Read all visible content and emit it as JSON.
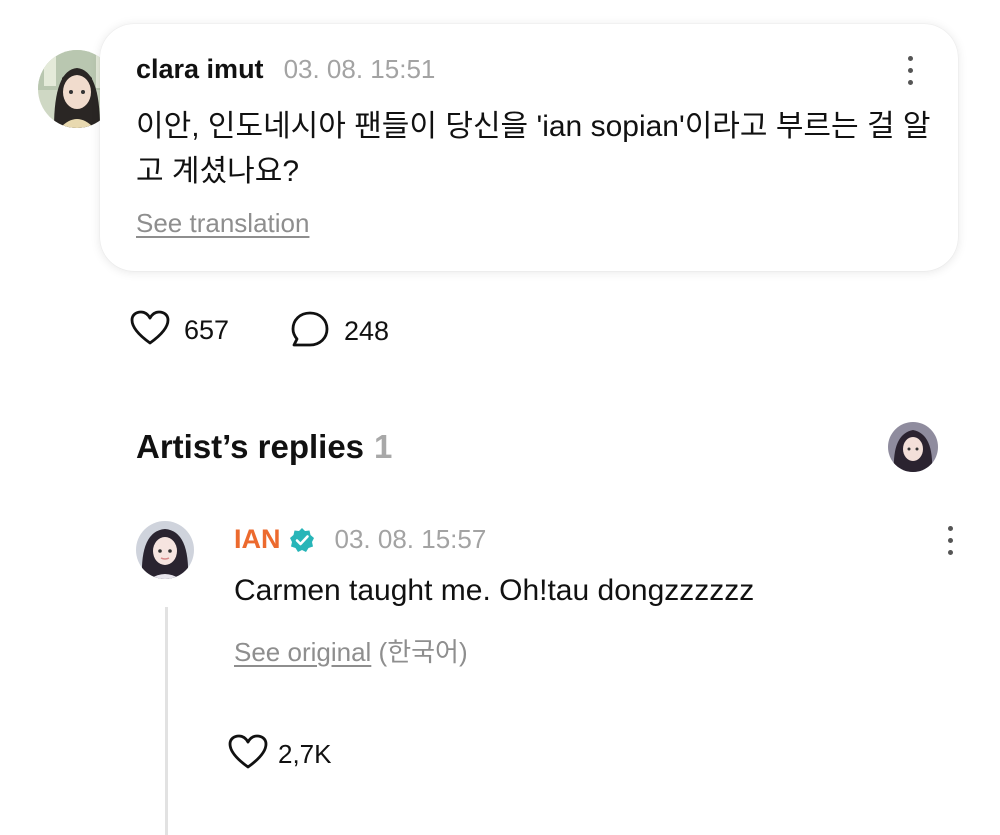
{
  "post": {
    "author": "clara imut",
    "timestamp": "03. 08. 15:51",
    "text": "이안, 인도네시아 팬들이 당신을 'ian sopian'이라고 부르는 걸 알고 계셨나요?",
    "see_translation": "See translation",
    "likes": "657",
    "comments": "248"
  },
  "artist_replies": {
    "title": "Artist’s replies",
    "count": "1"
  },
  "reply": {
    "author": "IAN",
    "timestamp": "03. 08. 15:57",
    "text": "Carmen taught me. Oh!tau dongzzzzzz",
    "see_original": "See original",
    "original_language": "(한국어)",
    "likes": "2,7K"
  },
  "colors": {
    "artist_name": "#ec6a2e",
    "verified_badge": "#27b5b8",
    "muted_text": "#a3a3a3"
  },
  "icons": [
    "kebab-menu-icon",
    "heart-icon",
    "comment-bubble-icon",
    "verified-badge-icon"
  ]
}
